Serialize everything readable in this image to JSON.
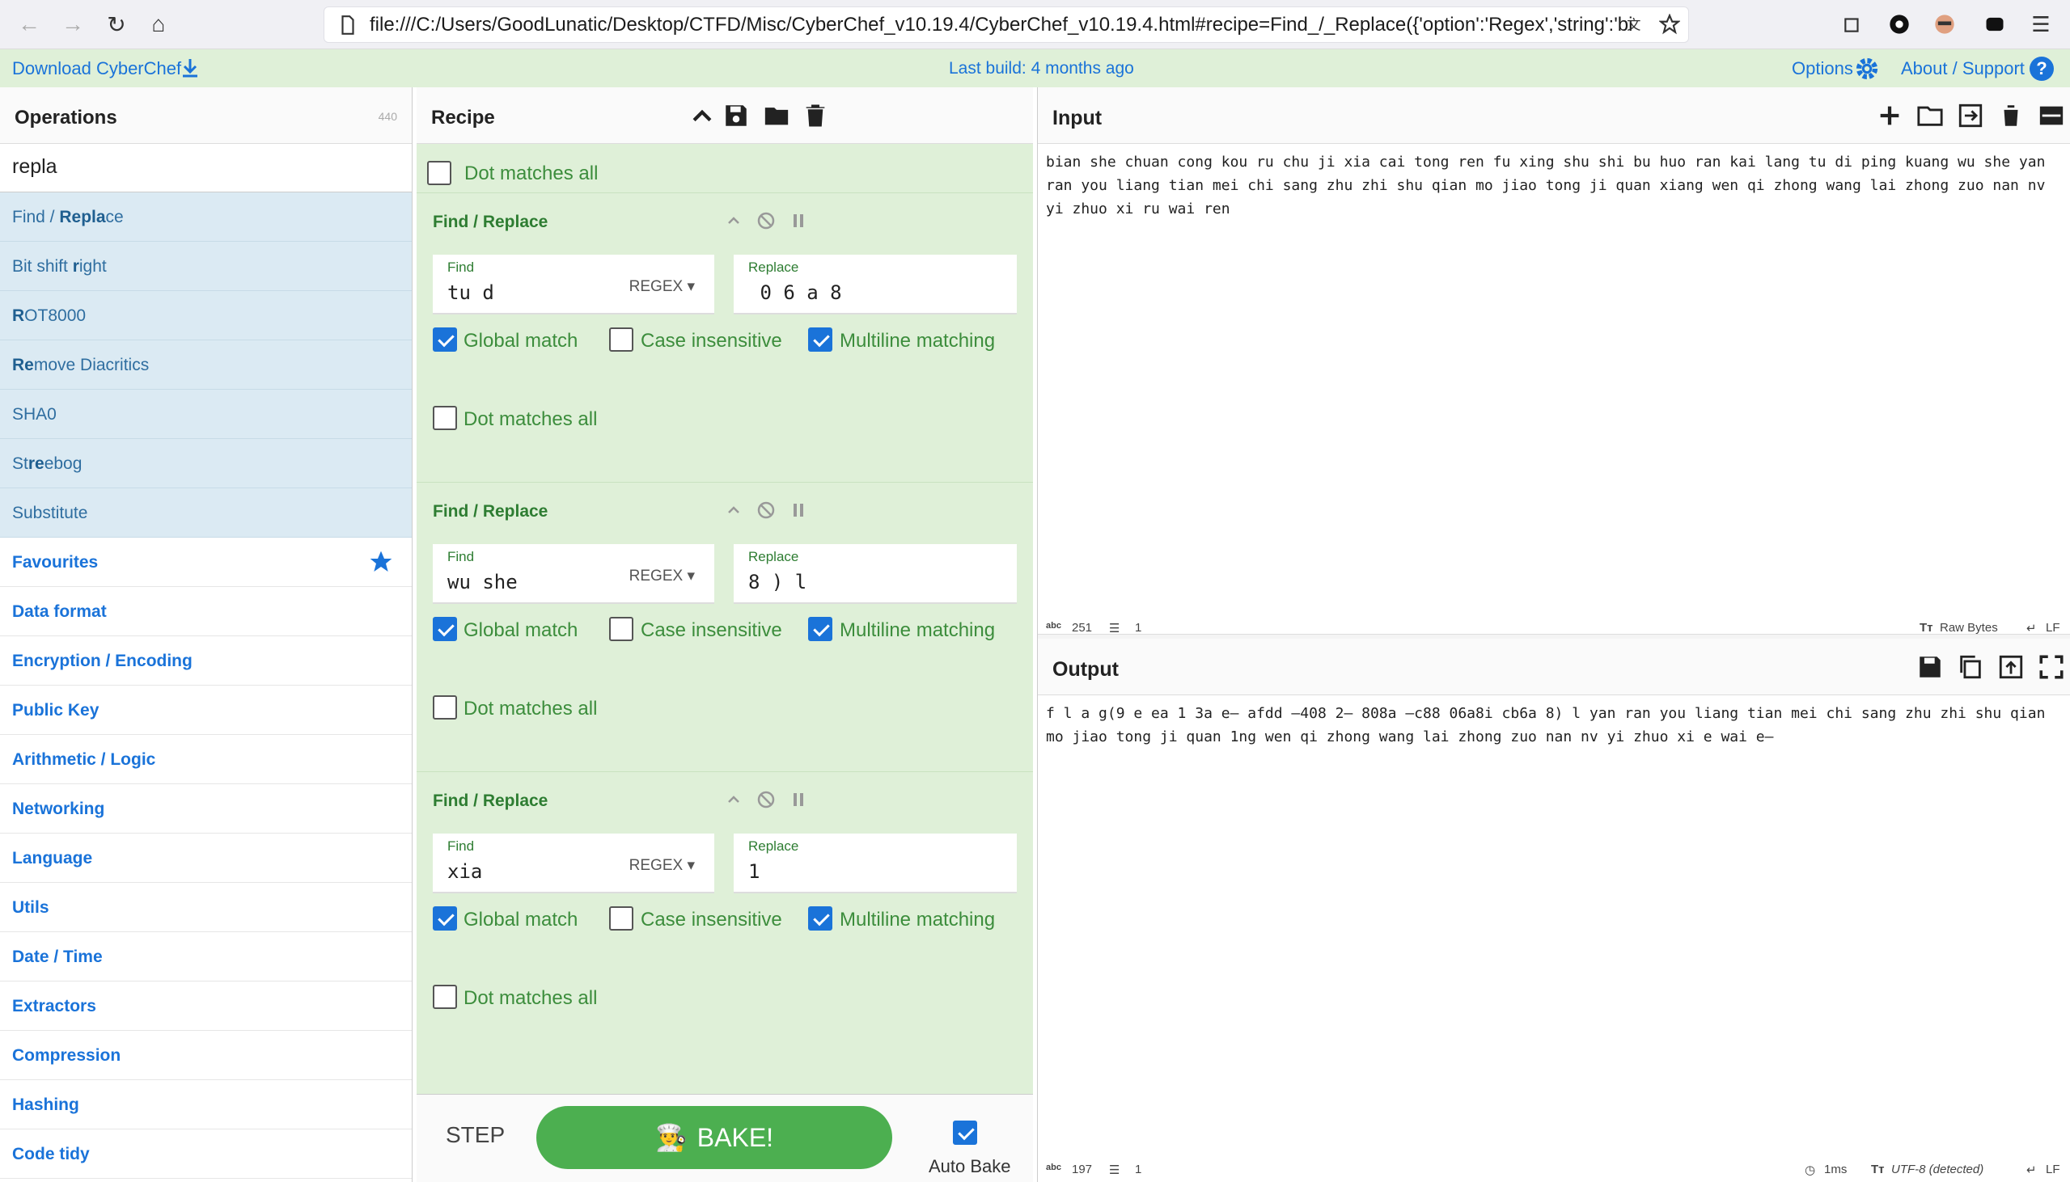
{
  "browser": {
    "url": "file:///C:/Users/GoodLunatic/Desktop/CTFD/Misc/CyberChef_v10.19.4/CyberChef_v10.19.4.html#recipe=Find_/_Replace({'option':'Regex','string':'bian'},'f',true"
  },
  "banner": {
    "download": "Download CyberChef",
    "last_build": "Last build: 4 months ago",
    "options": "Options",
    "about": "About / Support",
    "help": "?"
  },
  "operations": {
    "title": "Operations",
    "count": "440",
    "search": "repla",
    "results": [
      {
        "pre": "Find / ",
        "hl": "Repla",
        "post": "ce"
      },
      {
        "pre": "Bit shift ",
        "hl": "r",
        "post": "ight"
      },
      {
        "pre": "",
        "hl": "R",
        "post": "OT8000"
      },
      {
        "pre": "",
        "hl": "Re",
        "post": "move Diacritics"
      },
      {
        "pre": "SHA0",
        "hl": "",
        "post": ""
      },
      {
        "pre": "St",
        "hl": "re",
        "post": "ebog"
      },
      {
        "pre": "Substitute",
        "hl": "",
        "post": ""
      }
    ],
    "categories": [
      "Favourites",
      "Data format",
      "Encryption / Encoding",
      "Public Key",
      "Arithmetic / Logic",
      "Networking",
      "Language",
      "Utils",
      "Date / Time",
      "Extractors",
      "Compression",
      "Hashing",
      "Code tidy"
    ]
  },
  "recipe": {
    "title": "Recipe",
    "dot_label": "Dot matches all",
    "ops": [
      {
        "title": "Find / Replace",
        "find": "tu d",
        "mode": "REGEX",
        "replace": " 0 6 a 8",
        "global": "Global match",
        "case": "Case insensitive",
        "multi": "Multiline matching",
        "dot": "Dot matches all"
      },
      {
        "title": "Find / Replace",
        "find": "wu she",
        "mode": "REGEX",
        "replace": "8 ) l",
        "global": "Global match",
        "case": "Case insensitive",
        "multi": "Multiline matching",
        "dot": "Dot matches all"
      },
      {
        "title": "Find / Replace",
        "find": "xia",
        "mode": "REGEX",
        "replace": "1",
        "global": "Global match",
        "case": "Case insensitive",
        "multi": "Multiline matching",
        "dot": "Dot matches all"
      }
    ],
    "find_label": "Find",
    "replace_label": "Replace"
  },
  "bake": {
    "step": "STEP",
    "bake": "BAKE!",
    "auto": "Auto Bake"
  },
  "input": {
    "title": "Input",
    "text": "bian she chuan cong kou ru chu ji xia cai tong ren fu xing shu shi bu huo ran kai lang tu di ping kuang wu she yan ran you liang tian mei chi sang zhu zhi shu qian mo jiao tong ji quan xiang wen qi zhong wang lai zhong zuo nan nv yi zhuo xi ru wai ren",
    "chars": "251",
    "lines": "1",
    "raw": "Raw Bytes",
    "eol": "LF"
  },
  "output": {
    "title": "Output",
    "text": "f l a g(9 e ea 1 3a e— afdd —408 2— 808a —c88 06a8i cb6a 8) l yan ran you liang tian mei chi sang zhu zhi shu qian mo jiao tong ji quan 1ng wen qi zhong wang lai zhong zuo nan nv yi zhuo xi e wai e—",
    "chars": "197",
    "lines": "1",
    "time": "1ms",
    "enc": "UTF-8 (detected)",
    "eol": "LF"
  }
}
